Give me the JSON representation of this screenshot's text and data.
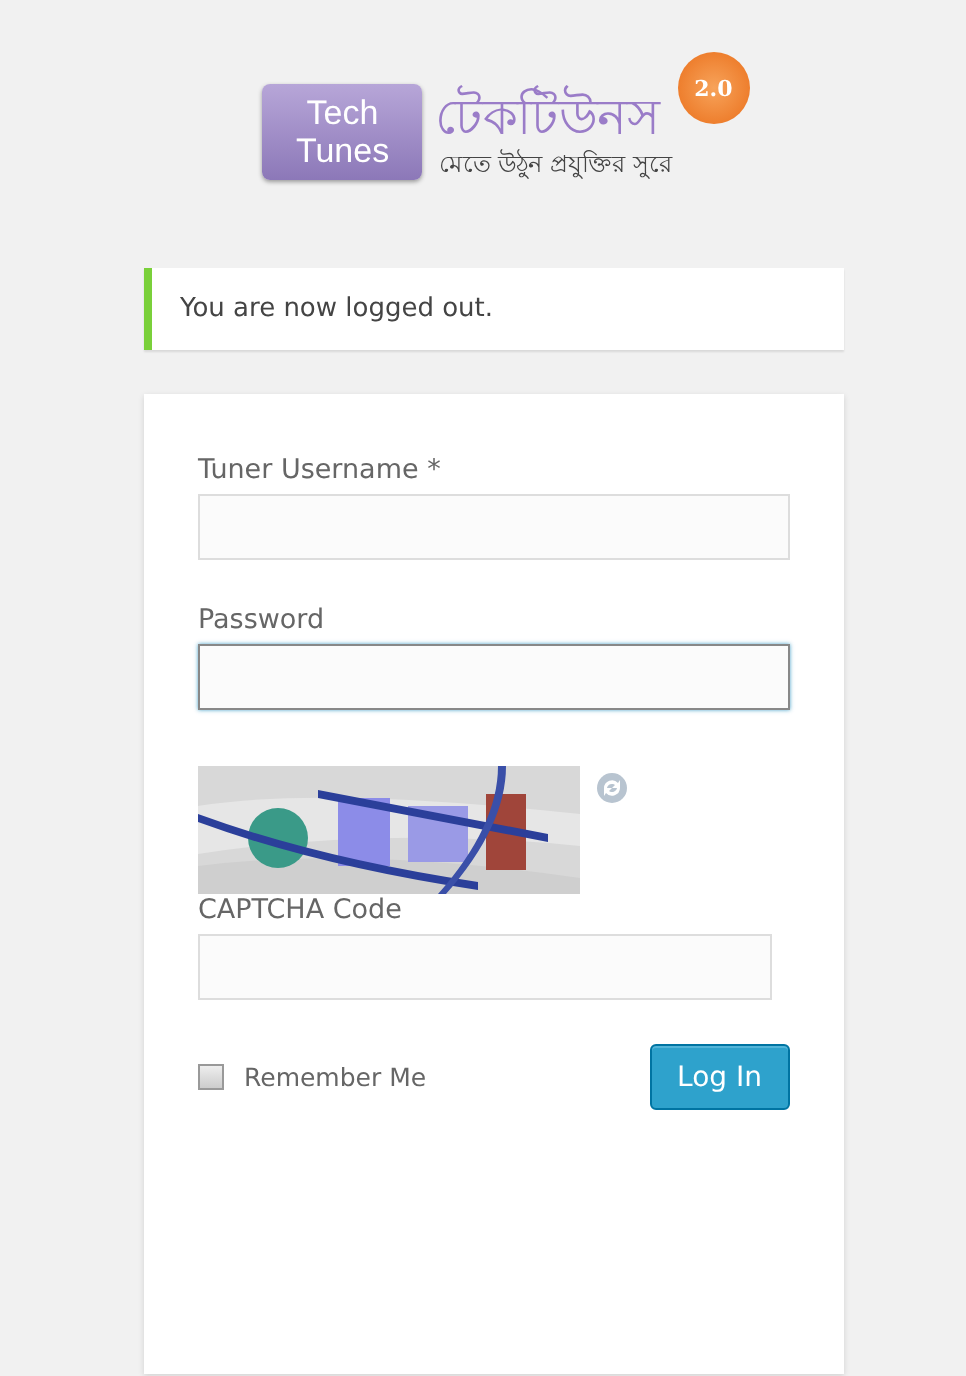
{
  "logo": {
    "badge_left": "Tech",
    "badge_right": "Tunes",
    "title": "টেকটিউনস",
    "version": "2.0",
    "tagline": "মেতে উঠুন প্রযুক্তির সুরে"
  },
  "notice": {
    "message": "You are now logged out."
  },
  "form": {
    "fields": [
      {
        "label": "Tuner Username *",
        "focused": false
      },
      {
        "label": "Password",
        "focused": true
      }
    ],
    "captcha": {
      "kind": "picture",
      "label": "CAPTCHA Code"
    },
    "remember": {
      "label": "Remember Me",
      "checked": false
    },
    "submit": "Log In"
  }
}
